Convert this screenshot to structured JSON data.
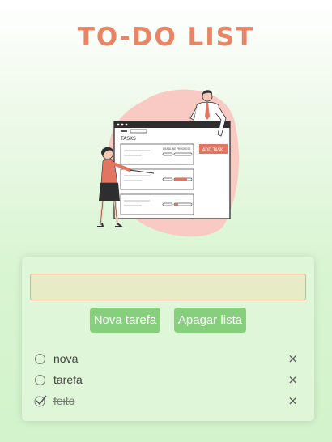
{
  "header": {
    "title": "TO-DO LIST"
  },
  "illustration": {
    "tasks_label": "TASKS",
    "add_task_label": "ADD TASK",
    "col_deadline": "DEADLINE",
    "col_progress": "PROGRESS"
  },
  "input": {
    "value": "",
    "placeholder": ""
  },
  "buttons": {
    "new_task": "Nova tarefa",
    "clear_list": "Apagar lista"
  },
  "tasks": [
    {
      "label": "nova",
      "done": false
    },
    {
      "label": "tarefa",
      "done": false
    },
    {
      "label": "feito",
      "done": true
    }
  ],
  "icons": {
    "delete": "close-icon",
    "unchecked": "radio-icon",
    "checked": "check-icon"
  },
  "colors": {
    "title": "#e98565",
    "button": "#86cf7c",
    "accent_blob": "#f9c9c4",
    "input_border": "#ecaa8c"
  }
}
